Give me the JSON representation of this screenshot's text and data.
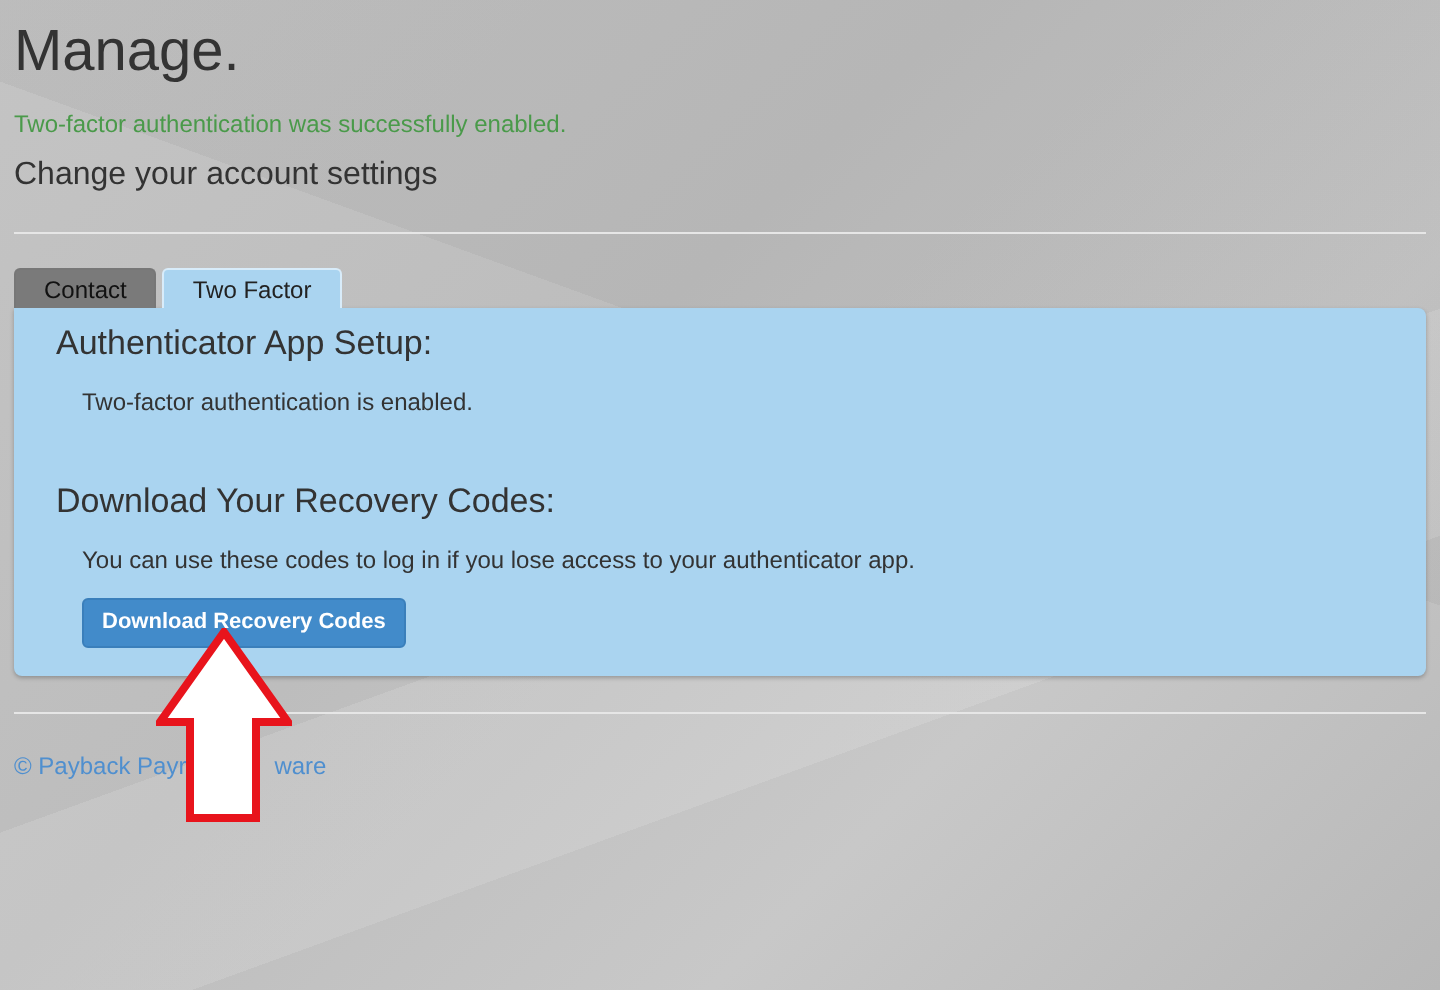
{
  "page": {
    "title": "Manage.",
    "status_message": "Two-factor authentication was successfully enabled.",
    "subtitle": "Change your account settings"
  },
  "tabs": [
    {
      "label": "Contact",
      "selected": false
    },
    {
      "label": "Two Factor",
      "selected": true
    }
  ],
  "panel": {
    "sections": [
      {
        "heading": "Authenticator App Setup:",
        "text": "Two-factor authentication is enabled."
      },
      {
        "heading": "Download Your Recovery Codes:",
        "text": "You can use these codes to log in if you lose access to your authenticator app.",
        "button": "Download Recovery Codes"
      }
    ]
  },
  "footer": {
    "parts": [
      "© Payback Payr",
      "ware"
    ]
  }
}
